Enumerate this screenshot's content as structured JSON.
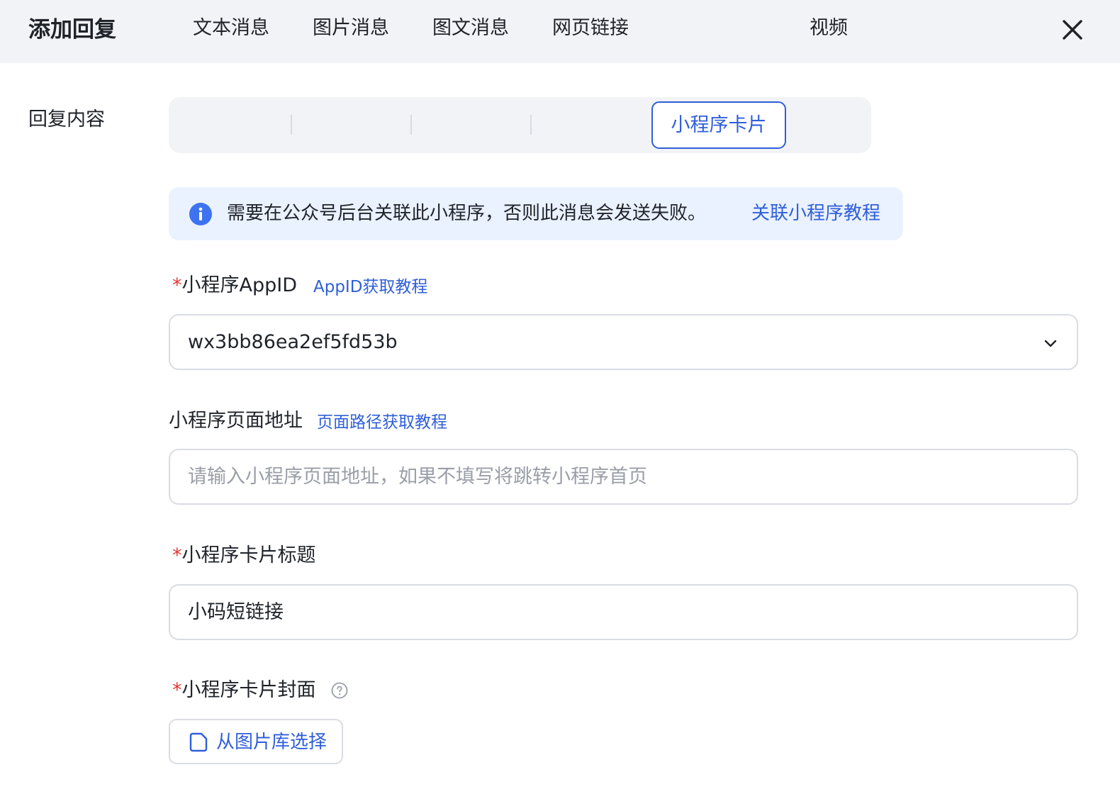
{
  "dialog": {
    "title": "添加回复",
    "close_icon": "close-icon"
  },
  "reply_content": {
    "label": "回复内容",
    "tabs": [
      {
        "label": "文本消息",
        "active": false
      },
      {
        "label": "图片消息",
        "active": false
      },
      {
        "label": "图文消息",
        "active": false
      },
      {
        "label": "网页链接",
        "active": false
      },
      {
        "label": "小程序卡片",
        "active": true
      },
      {
        "label": "视频",
        "active": false
      }
    ]
  },
  "notice": {
    "icon": "info-icon",
    "text": "需要在公众号后台关联此小程序，否则此消息会发送失败。",
    "link": "关联小程序教程"
  },
  "appid_field": {
    "required_mark": "*",
    "label": "小程序AppID",
    "help_link": "AppID获取教程",
    "value": "wx3bb86ea2ef5fd53b"
  },
  "page_path_field": {
    "label": "小程序页面地址",
    "help_link": "页面路径获取教程",
    "placeholder": "请输入小程序页面地址，如果不填写将跳转小程序首页"
  },
  "card_title_field": {
    "required_mark": "*",
    "label": "小程序卡片标题",
    "value": "小码短链接"
  },
  "card_cover_field": {
    "required_mark": "*",
    "label": "小程序卡片封面",
    "help_icon": "question-circle-icon",
    "button_label": "从图片库选择",
    "button_icon": "image-library-icon"
  },
  "colors": {
    "accent": "#2f5fd9",
    "required": "#e53935",
    "header_bg": "#f2f3f6",
    "notice_bg": "#eaf1ff"
  }
}
